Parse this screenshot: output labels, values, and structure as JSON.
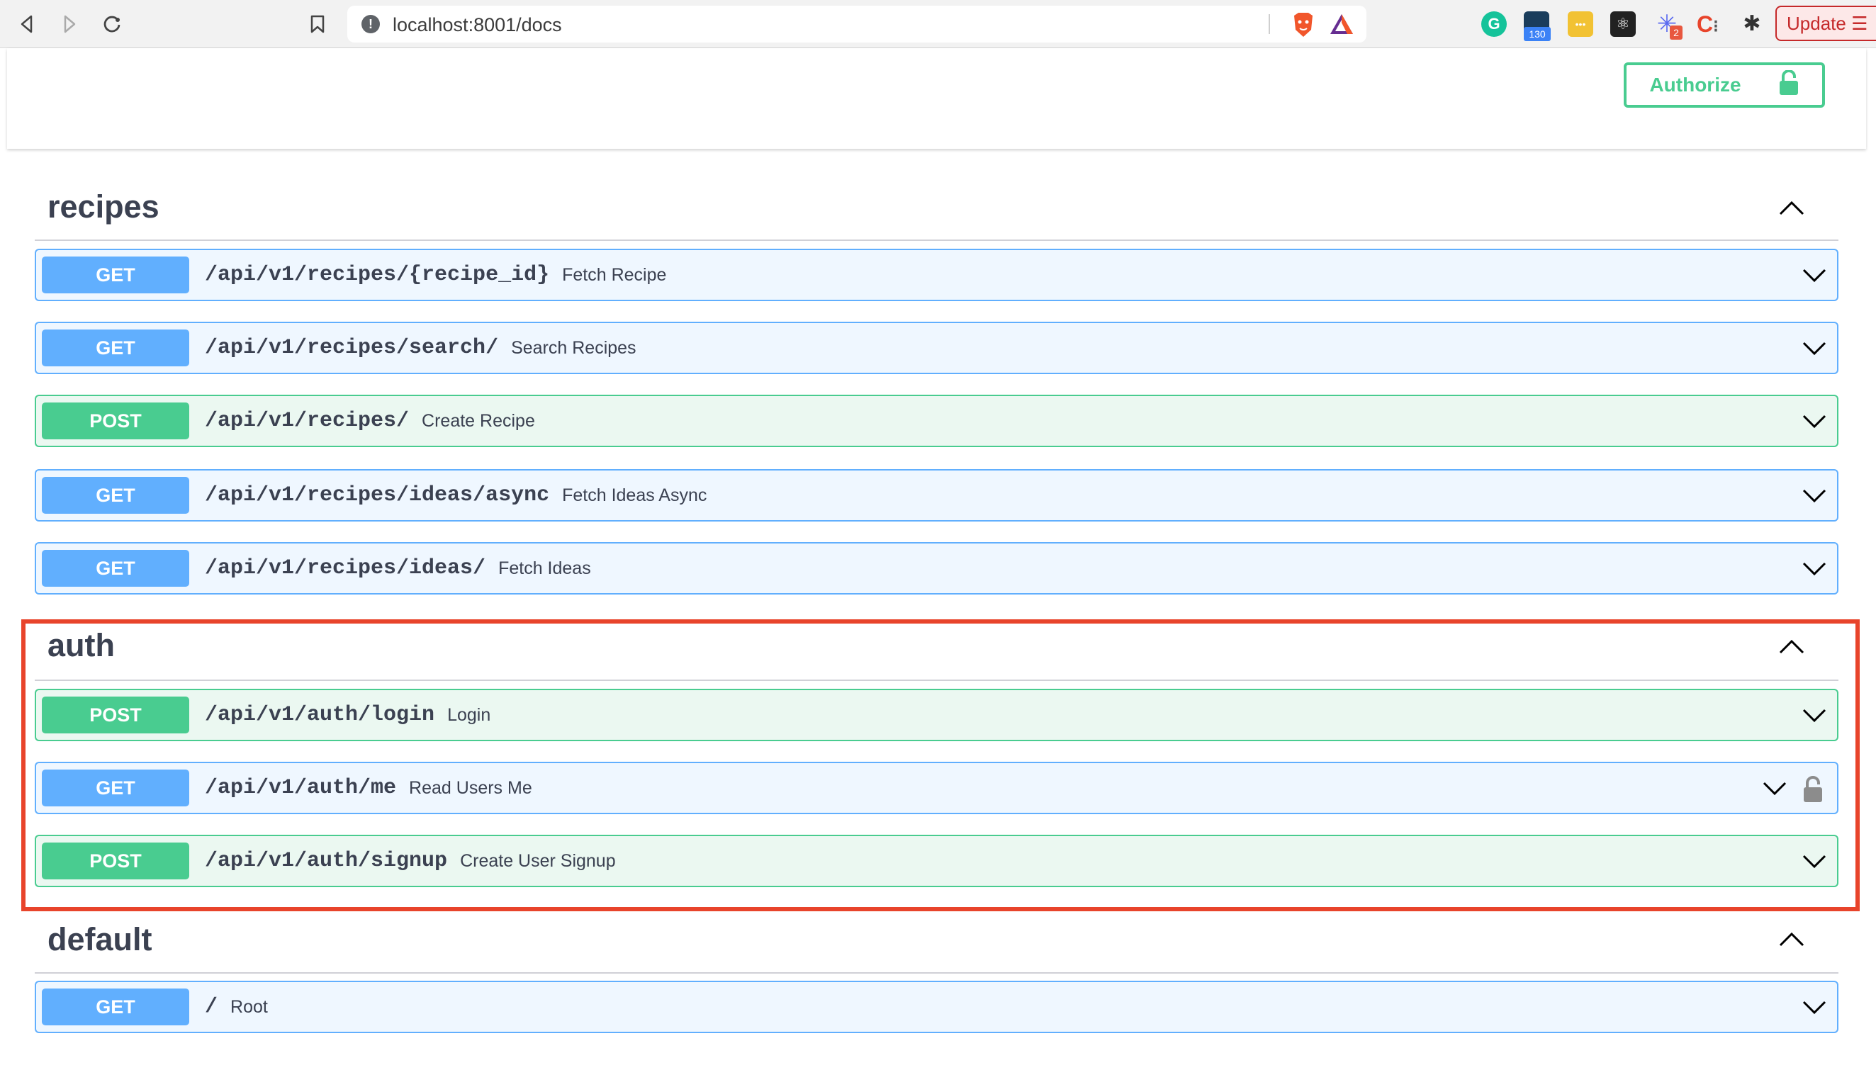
{
  "browser": {
    "url": "localhost:8001/docs",
    "update_label": "Update",
    "extensions": [
      {
        "name": "grammarly-icon",
        "color": "#15c39a"
      },
      {
        "name": "extension-counter-icon",
        "badge": "130",
        "color": "#1a3d5c"
      },
      {
        "name": "lastpass-icon",
        "color": "#f2c233"
      },
      {
        "name": "react-devtools-icon",
        "color": "#222222"
      },
      {
        "name": "extension-star-icon",
        "badge": "2",
        "color": "#5a6af0"
      },
      {
        "name": "extension-c-icon",
        "color": "#e8442b"
      },
      {
        "name": "extensions-puzzle-icon",
        "color": "#333333"
      }
    ]
  },
  "header": {
    "authorize_label": "Authorize"
  },
  "colors": {
    "get": "#61affe",
    "post": "#49cc90",
    "highlight": "#e8442b",
    "title": "#3b4151"
  },
  "sections": [
    {
      "name": "recipes",
      "operations": [
        {
          "method": "GET",
          "path": "/api/v1/recipes/{recipe_id}",
          "summary": "Fetch Recipe",
          "locked": false
        },
        {
          "method": "GET",
          "path": "/api/v1/recipes/search/",
          "summary": "Search Recipes",
          "locked": false
        },
        {
          "method": "POST",
          "path": "/api/v1/recipes/",
          "summary": "Create Recipe",
          "locked": false
        },
        {
          "method": "GET",
          "path": "/api/v1/recipes/ideas/async",
          "summary": "Fetch Ideas Async",
          "locked": false
        },
        {
          "method": "GET",
          "path": "/api/v1/recipes/ideas/",
          "summary": "Fetch Ideas",
          "locked": false
        }
      ]
    },
    {
      "name": "auth",
      "operations": [
        {
          "method": "POST",
          "path": "/api/v1/auth/login",
          "summary": "Login",
          "locked": false
        },
        {
          "method": "GET",
          "path": "/api/v1/auth/me",
          "summary": "Read Users Me",
          "locked": true
        },
        {
          "method": "POST",
          "path": "/api/v1/auth/signup",
          "summary": "Create User Signup",
          "locked": false
        }
      ]
    },
    {
      "name": "default",
      "operations": [
        {
          "method": "GET",
          "path": "/",
          "summary": "Root",
          "locked": false
        }
      ]
    }
  ]
}
